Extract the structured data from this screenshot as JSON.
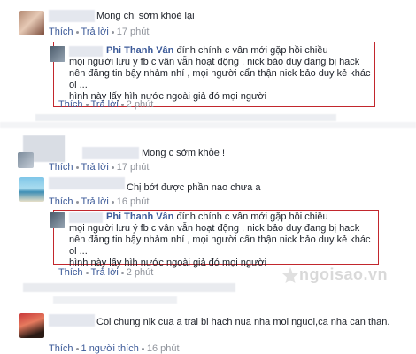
{
  "comments": [
    {
      "text": "Mong chị sớm khoẻ lại",
      "actions": {
        "like": "Thích",
        "reply": "Trả lời",
        "time": "17 phút"
      }
    },
    {
      "reply_name": "Phi Thanh Vân",
      "reply_text": "đính chính c vân mới gặp hồi chiều\nmọi người lưu ý fb c vân vẫn hoạt động , nick bảo duy đang bị hack nên đăng tin bậy nhảm nhí , mọi người cẩn thận nick bảo duy kẻ khác ol ...\nhình này lấy hìh nước ngoài giả đó mọi người",
      "actions": {
        "like": "Thích",
        "reply": "Trả lời",
        "time": "2 phút"
      }
    },
    {
      "text": "Mong c sớm khỏe !",
      "actions": {
        "like": "Thích",
        "reply": "Trả lời",
        "time": "17 phút"
      }
    },
    {
      "text": "Chị bớt được phần nao chưa a",
      "actions": {
        "like": "Thích",
        "reply": "Trả lời",
        "time": "16 phút"
      }
    },
    {
      "reply_name": "Phi Thanh Vân",
      "reply_text": "đính chính c vân mới gặp hồi chiều\nmọi người lưu ý fb c vân vẫn hoạt động , nick bảo duy đang bị hack nên đăng tin bậy nhảm nhí , mọi người cẩn thận nick bảo duy kẻ khác ol ...\nhình này lấy hìh nước ngoài giả đó mọi người",
      "actions": {
        "like": "Thích",
        "reply": "Trả lời",
        "time": "2 phút"
      }
    },
    {
      "text": "Coi chung nik cua a trai bi hach nua nha moi nguoi,ca nha can than.",
      "actions": {
        "like": "Thích",
        "reply": "1 người thích",
        "time": "16 phút"
      }
    }
  ],
  "watermark": "ngoisao.vn",
  "colors": {
    "link": "#3b5998",
    "meta": "#90949c",
    "highlight_border": "#c2272d"
  }
}
